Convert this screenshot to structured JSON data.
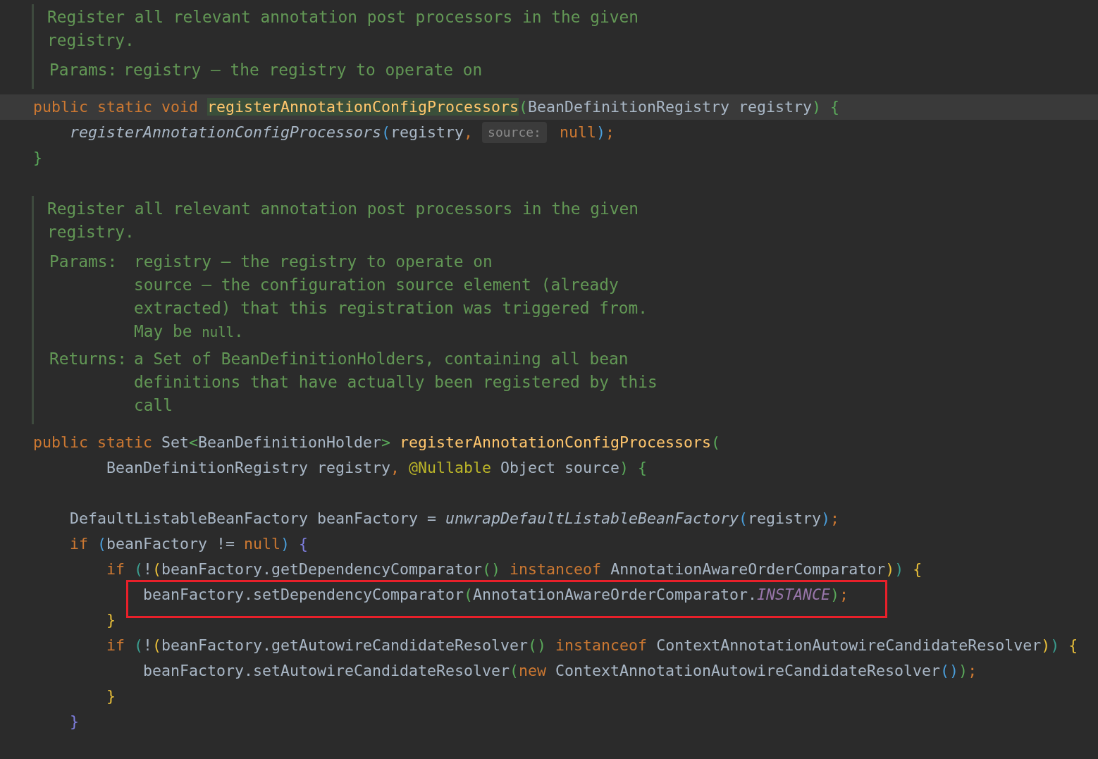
{
  "editor": {
    "blocks": [
      {
        "kind": "doc",
        "description": "Register all relevant annotation post processors in the given registry.",
        "sections": [
          {
            "label": "Params:",
            "entries": [
              {
                "text": "registry – the registry to operate on"
              }
            ]
          }
        ]
      },
      {
        "kind": "code",
        "lines": [
          {
            "current": true,
            "tokens": [
              {
                "t": "public static void ",
                "kind": "keyword"
              },
              {
                "t": "registerAnnotationConfigProcessors",
                "kind": "method",
                "highlighted": true
              },
              {
                "t": "(",
                "kind": "bracket",
                "color": "#5aa85a"
              },
              {
                "t": "BeanDefinitionRegistry registry",
                "kind": "plain"
              },
              {
                "t": ")",
                "kind": "bracket",
                "color": "#5aa85a"
              },
              {
                "t": " {",
                "kind": "bracket",
                "color": "#5aa85a"
              }
            ]
          },
          {
            "tokens": [
              {
                "t": "    registerAnnotationConfigProcessors",
                "kind": "static"
              },
              {
                "t": "(",
                "kind": "bracket",
                "color": "#4a9eda"
              },
              {
                "t": "registry",
                "kind": "plain"
              },
              {
                "t": ", ",
                "kind": "punct"
              },
              {
                "t": "source:",
                "kind": "hint"
              },
              {
                "t": " null",
                "kind": "keyword"
              },
              {
                "t": ")",
                "kind": "bracket",
                "color": "#4a9eda"
              },
              {
                "t": ";",
                "kind": "punct"
              }
            ]
          },
          {
            "tokens": [
              {
                "t": "}",
                "kind": "bracket",
                "color": "#5aa85a"
              }
            ]
          },
          {
            "kind": "blank"
          }
        ]
      },
      {
        "kind": "doc",
        "description": "Register all relevant annotation post processors in the given registry.",
        "sections": [
          {
            "label": "Params:",
            "entries": [
              {
                "text": "registry – the registry to operate on"
              },
              {
                "text": "source – the configuration source element (already extracted) that this registration was triggered from.",
                "note": {
                  "before": "May be ",
                  "code": "null",
                  "after": "."
                }
              }
            ]
          },
          {
            "label": "Returns:",
            "entries": [
              {
                "text": "a Set of BeanDefinitionHolders, containing all bean definitions that have actually been registered by this call"
              }
            ]
          }
        ]
      },
      {
        "kind": "code",
        "lines": [
          {
            "tokens": [
              {
                "t": "public static ",
                "kind": "keyword"
              },
              {
                "t": "Set",
                "kind": "plain"
              },
              {
                "t": "<",
                "kind": "bracket",
                "color": "#5aa85a"
              },
              {
                "t": "BeanDefinitionHolder",
                "kind": "plain"
              },
              {
                "t": "> ",
                "kind": "bracket",
                "color": "#5aa85a"
              },
              {
                "t": "registerAnnotationConfigProcessors",
                "kind": "method",
                "highlighted": false
              },
              {
                "t": "(",
                "kind": "bracket",
                "color": "#5aa85a"
              }
            ]
          },
          {
            "tokens": [
              {
                "t": "        BeanDefinitionRegistry registry",
                "kind": "plain"
              },
              {
                "t": ", ",
                "kind": "punct"
              },
              {
                "t": "@Nullable",
                "kind": "annotation"
              },
              {
                "t": " Object source",
                "kind": "plain"
              },
              {
                "t": ")",
                "kind": "bracket",
                "color": "#5aa85a"
              },
              {
                "t": " {",
                "kind": "bracket",
                "color": "#5aa85a"
              }
            ]
          },
          {
            "kind": "blank"
          },
          {
            "tokens": [
              {
                "t": "    DefaultListableBeanFactory beanFactory = ",
                "kind": "plain"
              },
              {
                "t": "unwrapDefaultListableBeanFactory",
                "kind": "static"
              },
              {
                "t": "(",
                "kind": "bracket",
                "color": "#4a9eda"
              },
              {
                "t": "registry",
                "kind": "plain"
              },
              {
                "t": ")",
                "kind": "bracket",
                "color": "#4a9eda"
              },
              {
                "t": ";",
                "kind": "punct"
              }
            ]
          },
          {
            "tokens": [
              {
                "t": "    if",
                "kind": "keyword"
              },
              {
                "t": " (",
                "kind": "bracket",
                "color": "#4a9eda"
              },
              {
                "t": "beanFactory != ",
                "kind": "plain"
              },
              {
                "t": "null",
                "kind": "keyword"
              },
              {
                "t": ")",
                "kind": "bracket",
                "color": "#4a9eda"
              },
              {
                "t": " {",
                "kind": "bracket",
                "color": "#7f7fe0"
              }
            ]
          },
          {
            "tokens": [
              {
                "t": "        if",
                "kind": "keyword"
              },
              {
                "t": " (",
                "kind": "bracket",
                "color": "#3a9d8f"
              },
              {
                "t": "!",
                "kind": "plain"
              },
              {
                "t": "(",
                "kind": "bracket",
                "color": "#e8bf3a"
              },
              {
                "t": "beanFactory.getDependencyComparator",
                "kind": "plain"
              },
              {
                "t": "()",
                "kind": "bracket",
                "color": "#5aa85a"
              },
              {
                "t": " instanceof",
                "kind": "keyword"
              },
              {
                "t": " AnnotationAwareOrderComparator",
                "kind": "plain"
              },
              {
                "t": ")",
                "kind": "bracket",
                "color": "#e8bf3a"
              },
              {
                "t": ")",
                "kind": "bracket",
                "color": "#3a9d8f"
              },
              {
                "t": " {",
                "kind": "bracket",
                "color": "#e8bf3a"
              }
            ]
          },
          {
            "boxed": true,
            "tokens": [
              {
                "t": "            beanFactory.setDependencyComparator",
                "kind": "plain"
              },
              {
                "t": "(",
                "kind": "bracket",
                "color": "#5aa85a"
              },
              {
                "t": "AnnotationAwareOrderComparator.",
                "kind": "plain"
              },
              {
                "t": "INSTANCE",
                "kind": "constant"
              },
              {
                "t": ")",
                "kind": "bracket",
                "color": "#5aa85a"
              },
              {
                "t": ";",
                "kind": "punct"
              }
            ]
          },
          {
            "tokens": [
              {
                "t": "        }",
                "kind": "bracket",
                "color": "#e8bf3a"
              }
            ]
          },
          {
            "tokens": [
              {
                "t": "        if",
                "kind": "keyword"
              },
              {
                "t": " (",
                "kind": "bracket",
                "color": "#3a9d8f"
              },
              {
                "t": "!",
                "kind": "plain"
              },
              {
                "t": "(",
                "kind": "bracket",
                "color": "#e8bf3a"
              },
              {
                "t": "beanFactory.getAutowireCandidateResolver",
                "kind": "plain"
              },
              {
                "t": "()",
                "kind": "bracket",
                "color": "#5aa85a"
              },
              {
                "t": " instanceof",
                "kind": "keyword"
              },
              {
                "t": " ContextAnnotationAutowireCandidateResolver",
                "kind": "plain"
              },
              {
                "t": ")",
                "kind": "bracket",
                "color": "#e8bf3a"
              },
              {
                "t": ")",
                "kind": "bracket",
                "color": "#3a9d8f"
              },
              {
                "t": " {",
                "kind": "bracket",
                "color": "#e8bf3a"
              }
            ]
          },
          {
            "tokens": [
              {
                "t": "            beanFactory.setAutowireCandidateResolver",
                "kind": "plain"
              },
              {
                "t": "(",
                "kind": "bracket",
                "color": "#5aa85a"
              },
              {
                "t": "new",
                "kind": "keyword"
              },
              {
                "t": " ContextAnnotationAutowireCandidateResolver",
                "kind": "plain"
              },
              {
                "t": "()",
                "kind": "bracket",
                "color": "#4a9eda"
              },
              {
                "t": ")",
                "kind": "bracket",
                "color": "#5aa85a"
              },
              {
                "t": ";",
                "kind": "punct"
              }
            ]
          },
          {
            "tokens": [
              {
                "t": "        }",
                "kind": "bracket",
                "color": "#e8bf3a"
              }
            ]
          },
          {
            "tokens": [
              {
                "t": "    }",
                "kind": "bracket",
                "color": "#7f7fe0"
              }
            ]
          }
        ]
      }
    ]
  }
}
